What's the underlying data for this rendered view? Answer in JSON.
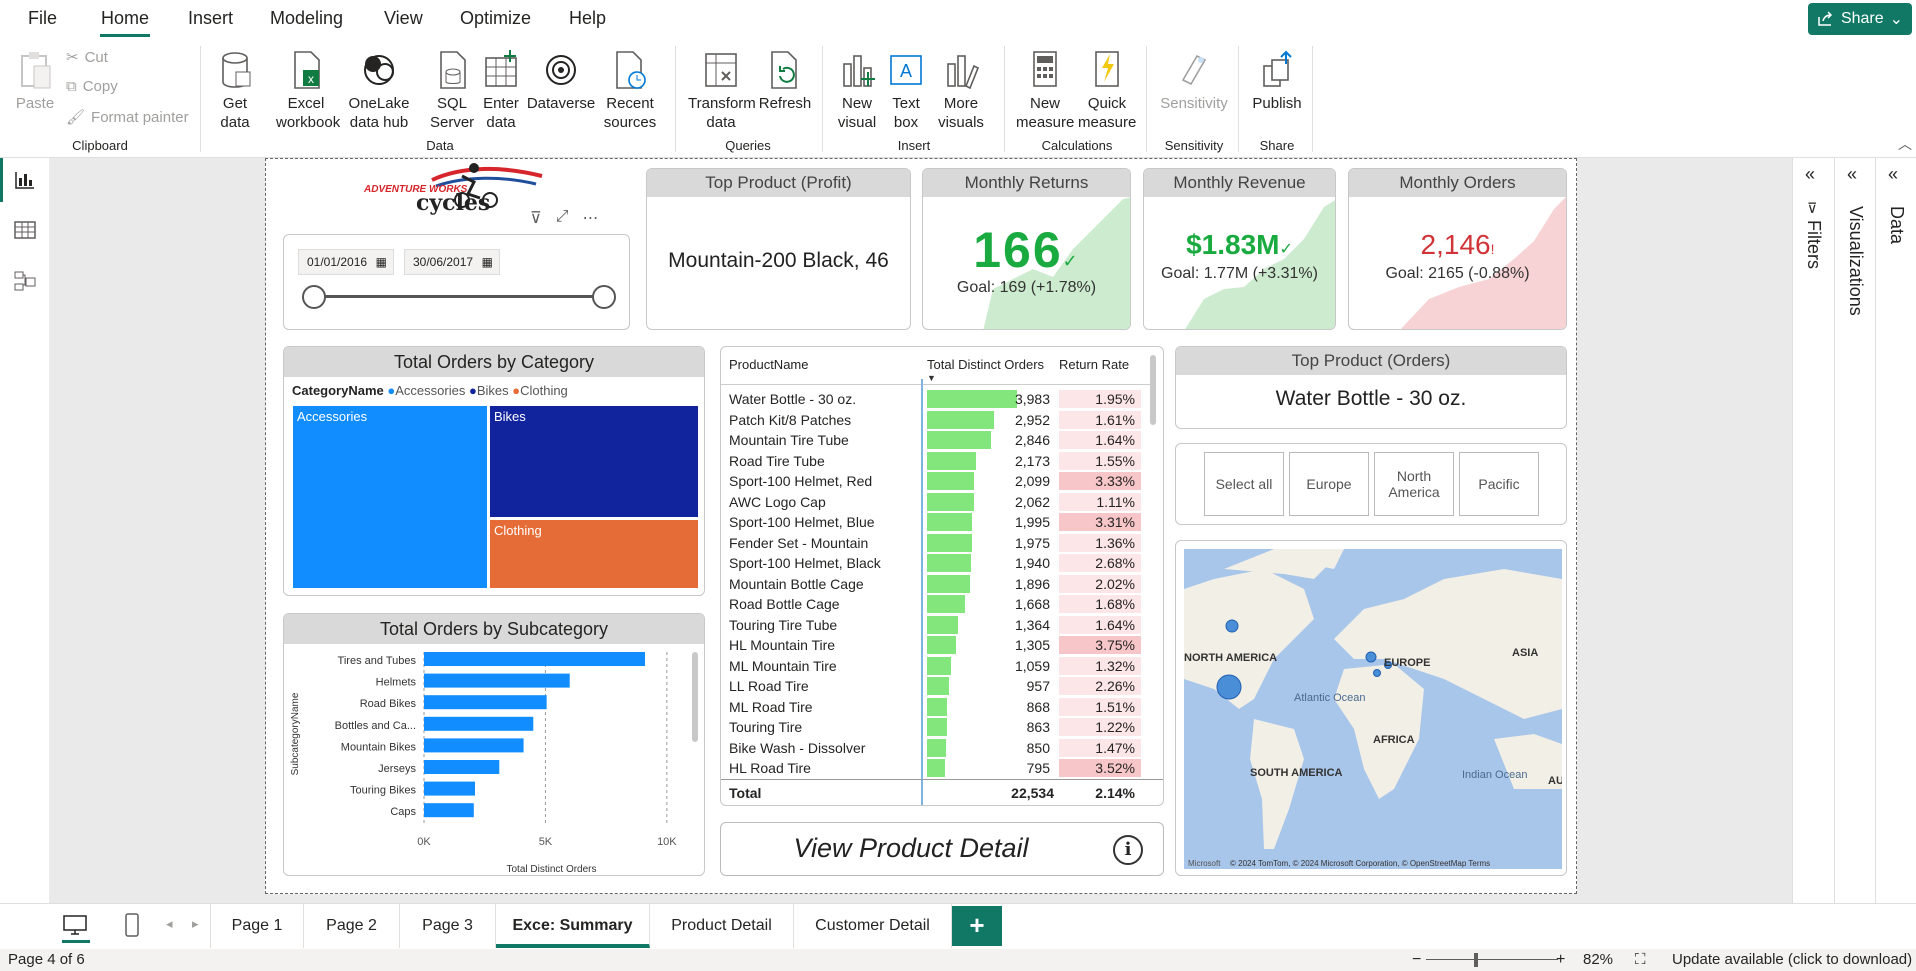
{
  "menu": {
    "file": "File",
    "home": "Home",
    "insert": "Insert",
    "modeling": "Modeling",
    "view": "View",
    "optimize": "Optimize",
    "help": "Help",
    "share": "Share"
  },
  "ribbon": {
    "paste": "Paste",
    "cut": "Cut",
    "copy": "Copy",
    "format_painter": "Format painter",
    "get_data": "Get data",
    "excel": "Excel workbook",
    "onelake": "OneLake data hub",
    "sql": "SQL Server",
    "enter_data": "Enter data",
    "dataverse": "Dataverse",
    "recent": "Recent sources",
    "transform": "Transform data",
    "refresh": "Refresh",
    "new_visual": "New visual",
    "text_box": "Text box",
    "more_visuals": "More visuals",
    "new_measure": "New measure",
    "quick_measure": "Quick measure",
    "sensitivity": "Sensitivity",
    "publish": "Publish",
    "groups": {
      "clipboard": "Clipboard",
      "data": "Data",
      "queries": "Queries",
      "insert": "Insert",
      "calculations": "Calculations",
      "sensitivity": "Sensitivity",
      "share": "Share"
    }
  },
  "logo": {
    "line1": "ADVENTURE WORKS",
    "line2": "cycles"
  },
  "date_slicer": {
    "start": "01/01/2016",
    "end": "30/06/2017"
  },
  "cards": {
    "top_profit": {
      "title": "Top Product (Profit)",
      "value": "Mountain-200 Black, 46"
    },
    "returns": {
      "title": "Monthly Returns",
      "value": "166",
      "mark": "✓",
      "goal": "Goal: 169 (+1.78%)"
    },
    "revenue": {
      "title": "Monthly Revenue",
      "value": "$1.83M",
      "mark": "✓",
      "goal": "Goal: 1.77M (+3.31%)"
    },
    "orders": {
      "title": "Monthly Orders",
      "value": "2,146",
      "mark": "!",
      "goal": "Goal: 2165 (-0.88%)"
    },
    "top_orders": {
      "title": "Top Product (Orders)",
      "value": "Water Bottle - 30 oz."
    }
  },
  "treemap": {
    "title": "Total Orders by Category",
    "legend_title": "CategoryName",
    "items": [
      {
        "name": "Accessories",
        "color": "#118dff"
      },
      {
        "name": "Bikes",
        "color": "#12239e"
      },
      {
        "name": "Clothing",
        "color": "#e66c37"
      }
    ]
  },
  "subcat_chart": {
    "title": "Total Orders by Subcategory",
    "xlabel": "Total Distinct Orders",
    "ylabel": "SubcategoryName",
    "ticks": [
      "0K",
      "5K",
      "10K"
    ]
  },
  "chart_data": {
    "type": "bar",
    "title": "Total Orders by Subcategory",
    "xlabel": "Total Distinct Orders",
    "ylabel": "SubcategoryName",
    "categories": [
      "Tires and Tubes",
      "Helmets",
      "Road Bikes",
      "Bottles and Ca...",
      "Mountain Bikes",
      "Jerseys",
      "Touring Bikes",
      "Caps"
    ],
    "values": [
      9100,
      6000,
      5050,
      4500,
      4100,
      3100,
      2100,
      2050
    ],
    "xlim": [
      0,
      10500
    ],
    "color": "#118dff"
  },
  "table": {
    "headers": [
      "ProductName",
      "Total Distinct Orders",
      "Return Rate"
    ],
    "max_orders": 3983,
    "rows": [
      [
        "Water Bottle - 30 oz.",
        "3,983",
        "1.95%",
        3983,
        0
      ],
      [
        "Patch Kit/8 Patches",
        "2,952",
        "1.61%",
        2952,
        0
      ],
      [
        "Mountain Tire Tube",
        "2,846",
        "1.64%",
        2846,
        0
      ],
      [
        "Road Tire Tube",
        "2,173",
        "1.55%",
        2173,
        0
      ],
      [
        "Sport-100 Helmet, Red",
        "2,099",
        "3.33%",
        2099,
        1
      ],
      [
        "AWC Logo Cap",
        "2,062",
        "1.11%",
        2062,
        0
      ],
      [
        "Sport-100 Helmet, Blue",
        "1,995",
        "3.31%",
        1995,
        1
      ],
      [
        "Fender Set - Mountain",
        "1,975",
        "1.36%",
        1975,
        0
      ],
      [
        "Sport-100 Helmet, Black",
        "1,940",
        "2.68%",
        1940,
        0
      ],
      [
        "Mountain Bottle Cage",
        "1,896",
        "2.02%",
        1896,
        0
      ],
      [
        "Road Bottle Cage",
        "1,668",
        "1.68%",
        1668,
        0
      ],
      [
        "Touring Tire Tube",
        "1,364",
        "1.64%",
        1364,
        0
      ],
      [
        "HL Mountain Tire",
        "1,305",
        "3.75%",
        1305,
        1
      ],
      [
        "ML Mountain Tire",
        "1,059",
        "1.32%",
        1059,
        0
      ],
      [
        "LL Road Tire",
        "957",
        "2.26%",
        957,
        0
      ],
      [
        "ML Road Tire",
        "868",
        "1.51%",
        868,
        0
      ],
      [
        "Touring Tire",
        "863",
        "1.22%",
        863,
        0
      ],
      [
        "Bike Wash - Dissolver",
        "850",
        "1.47%",
        850,
        0
      ],
      [
        "HL Road Tire",
        "795",
        "3.52%",
        795,
        1
      ]
    ],
    "total_label": "Total",
    "total_orders": "22,534",
    "total_rate": "2.14%"
  },
  "region_slicer": [
    "Select all",
    "Europe",
    "North America",
    "Pacific"
  ],
  "map": {
    "labels": [
      "NORTH AMERICA",
      "EUROPE",
      "ASIA",
      "Atlantic Ocean",
      "AFRICA",
      "SOUTH AMERICA",
      "Indian Ocean",
      "AU"
    ],
    "attribution": "© 2024 TomTom, © 2024 Microsoft Corporation, © OpenStreetMap  Terms",
    "brand": "Microsoft"
  },
  "view_detail": "View Product Detail",
  "panes": {
    "filters": "Filters",
    "visualizations": "Visualizations",
    "data": "Data"
  },
  "tabs": [
    "Page 1",
    "Page 2",
    "Page 3",
    "Exce: Summary",
    "Product Detail",
    "Customer Detail"
  ],
  "status": {
    "page": "Page 4 of 6",
    "zoom": "82%",
    "update": "Update available (click to download)"
  }
}
